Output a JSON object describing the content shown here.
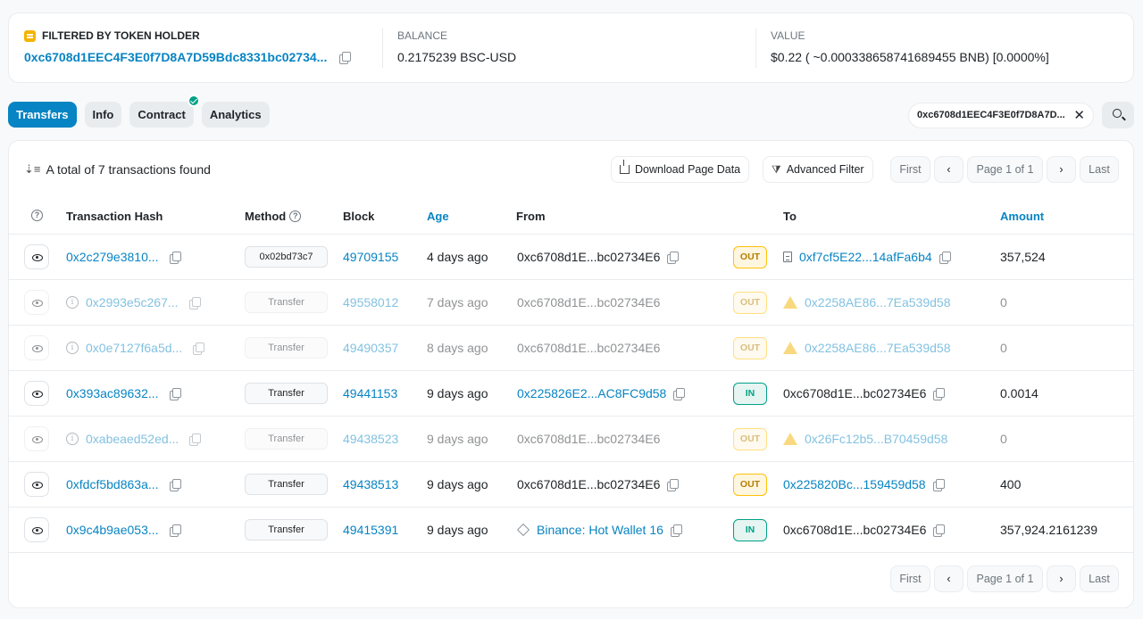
{
  "summary": {
    "holder_label": "FILTERED BY TOKEN HOLDER",
    "holder_address": "0xc6708d1EEC4F3E0f7D8A7D59Bdc8331bc02734...",
    "balance_label": "BALANCE",
    "balance_value": "0.2175239 BSC-USD",
    "value_label": "VALUE",
    "value_value": "$0.22 ( ~0.000338658741689455 BNB) [0.0000%]"
  },
  "tabs": [
    "Transfers",
    "Info",
    "Contract",
    "Analytics"
  ],
  "filter_chip": "0xc6708d1EEC4F3E0f7D8A7D...",
  "toolbar": {
    "total": "A total of 7 transactions found",
    "download": "Download Page Data",
    "advanced_filter": "Advanced Filter",
    "first": "First",
    "page": "Page 1 of 1",
    "last": "Last"
  },
  "columns": {
    "hash": "Transaction Hash",
    "method": "Method",
    "block": "Block",
    "age": "Age",
    "from": "From",
    "to": "To",
    "amount": "Amount"
  },
  "rows": [
    {
      "hash": "0x2c279e3810...",
      "method": "0x02bd73c7",
      "block": "49709155",
      "age": "4 days ago",
      "from": "0xc6708d1E...bc02734E6",
      "dir": "OUT",
      "to": "0xf7cf5E22...14afFa6b4",
      "amount": "357,524"
    },
    {
      "hash": "0x2993e5c267...",
      "method": "Transfer",
      "block": "49558012",
      "age": "7 days ago",
      "from": "0xc6708d1E...bc02734E6",
      "dir": "OUT",
      "to": "0x2258AE86...7Ea539d58",
      "amount": "0"
    },
    {
      "hash": "0x0e7127f6a5d...",
      "method": "Transfer",
      "block": "49490357",
      "age": "8 days ago",
      "from": "0xc6708d1E...bc02734E6",
      "dir": "OUT",
      "to": "0x2258AE86...7Ea539d58",
      "amount": "0"
    },
    {
      "hash": "0x393ac89632...",
      "method": "Transfer",
      "block": "49441153",
      "age": "9 days ago",
      "from": "0x225826E2...AC8FC9d58",
      "dir": "IN",
      "to": "0xc6708d1E...bc02734E6",
      "amount": "0.0014"
    },
    {
      "hash": "0xabeaed52ed...",
      "method": "Transfer",
      "block": "49438523",
      "age": "9 days ago",
      "from": "0xc6708d1E...bc02734E6",
      "dir": "OUT",
      "to": "0x26Fc12b5...B70459d58",
      "amount": "0"
    },
    {
      "hash": "0xfdcf5bd863a...",
      "method": "Transfer",
      "block": "49438513",
      "age": "9 days ago",
      "from": "0xc6708d1E...bc02734E6",
      "dir": "OUT",
      "to": "0x225820Bc...159459d58",
      "amount": "400"
    },
    {
      "hash": "0x9c4b9ae053...",
      "method": "Transfer",
      "block": "49415391",
      "age": "9 days ago",
      "from": "Binance: Hot Wallet 16",
      "dir": "IN",
      "to": "0xc6708d1E...bc02734E6",
      "amount": "357,924.2161239"
    }
  ]
}
